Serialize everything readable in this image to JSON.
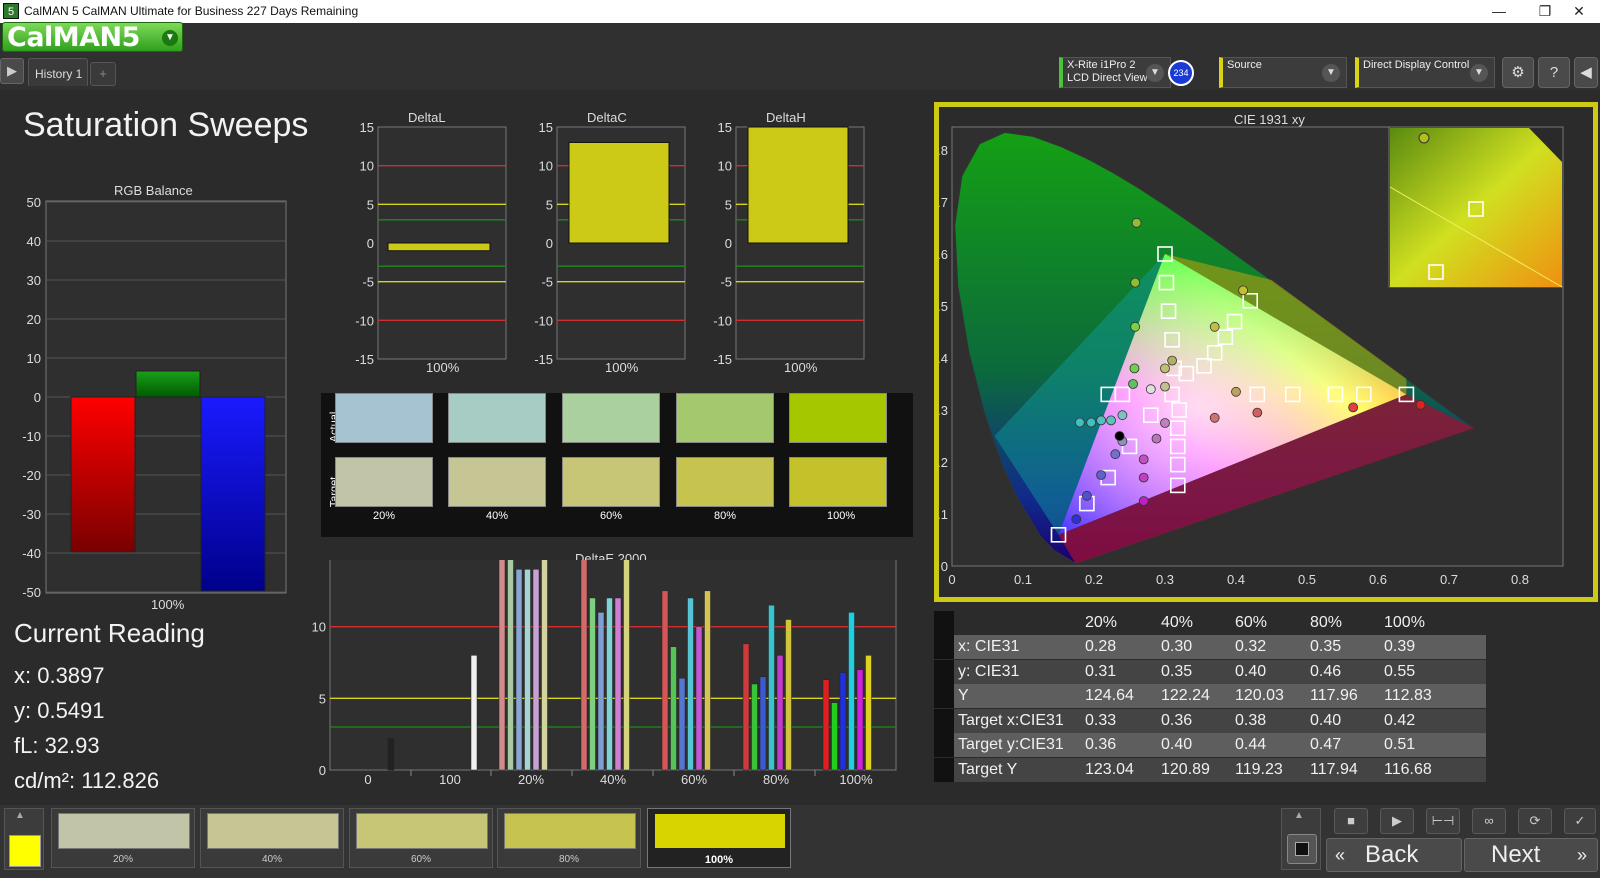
{
  "window": {
    "title": "CalMAN 5 CalMAN Ultimate for Business 227 Days Remaining",
    "app_icon": "5",
    "minimize": "—",
    "maximize": "❐",
    "close": "✕"
  },
  "toolbar": {
    "logo": "CalMAN5",
    "tab": "History 1",
    "add_tab": "+",
    "meter_line1": "X-Rite i1Pro 2",
    "meter_line2": "LCD Direct View",
    "badge": "234",
    "source": "Source",
    "display": "Direct Display Control",
    "dropdown_glyph": "▼"
  },
  "page": {
    "title": "Saturation Sweeps"
  },
  "rgb_balance": {
    "title": "RGB Balance",
    "category": "100%",
    "yticks": [
      "50",
      "40",
      "30",
      "20",
      "10",
      "0",
      "-10",
      "-20",
      "-30",
      "-40",
      "-50"
    ]
  },
  "delta_charts": {
    "yticks": [
      "15",
      "10",
      "5",
      "0",
      "-5",
      "-10",
      "-15"
    ],
    "category": "100%",
    "titles": [
      "DeltaL",
      "DeltaC",
      "DeltaH"
    ]
  },
  "swatches": {
    "actual_label": "Actual",
    "target_label": "Target",
    "labels": [
      "20%",
      "40%",
      "60%",
      "80%",
      "100%"
    ],
    "actual_colors": [
      "#a5c3d1",
      "#a7ccc3",
      "#a9d09e",
      "#a3c86d",
      "#a4c700"
    ],
    "target_colors": [
      "#c2c4a8",
      "#c6c594",
      "#c6c676",
      "#c6c44f",
      "#c4c22a"
    ]
  },
  "deltae": {
    "title": "DeltaE 2000",
    "yticks": [
      "15",
      "10",
      "5",
      "0"
    ],
    "xticks": [
      "0",
      "100",
      "20%",
      "40%",
      "60%",
      "80%",
      "100%"
    ]
  },
  "current_reading": {
    "title": "Current Reading",
    "x": "x: 0.3897",
    "y": "y: 0.5491",
    "fl": "fL: 32.93",
    "cdm2": "cd/m²: 112.826"
  },
  "cie": {
    "title": "CIE 1931 xy",
    "xticks": [
      "0",
      "0.1",
      "0.2",
      "0.3",
      "0.4",
      "0.5",
      "0.6",
      "0.7",
      "0.8"
    ],
    "yticks": [
      "0.8",
      "0.7",
      "0.6",
      "0.5",
      "0.4",
      "0.3",
      "0.2",
      "0.1",
      "0"
    ]
  },
  "table": {
    "headers": [
      "20%",
      "40%",
      "60%",
      "80%",
      "100%"
    ],
    "rows": [
      {
        "label": "x: CIE31",
        "values": [
          "0.28",
          "0.30",
          "0.32",
          "0.35",
          "0.39"
        ]
      },
      {
        "label": "y: CIE31",
        "values": [
          "0.31",
          "0.35",
          "0.40",
          "0.46",
          "0.55"
        ]
      },
      {
        "label": "Y",
        "values": [
          "124.64",
          "122.24",
          "120.03",
          "117.96",
          "112.83"
        ]
      },
      {
        "label": "Target x:CIE31",
        "values": [
          "0.33",
          "0.36",
          "0.38",
          "0.40",
          "0.42"
        ]
      },
      {
        "label": "Target y:CIE31",
        "values": [
          "0.36",
          "0.40",
          "0.44",
          "0.47",
          "0.51"
        ]
      },
      {
        "label": "Target Y",
        "values": [
          "123.04",
          "120.89",
          "119.23",
          "117.94",
          "116.68"
        ]
      }
    ]
  },
  "bottom": {
    "thumbs": [
      "20%",
      "40%",
      "60%",
      "80%",
      "100%"
    ],
    "back": "Back",
    "next": "Next"
  },
  "colors": {
    "accent_green": "#4bc43b",
    "highlight_yellow": "#cdca17"
  }
}
